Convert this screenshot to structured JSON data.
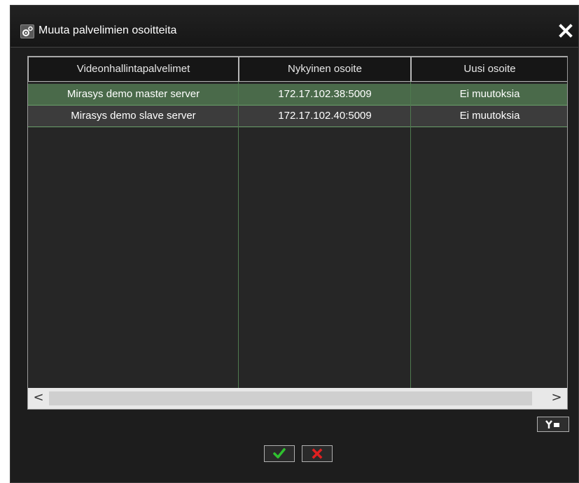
{
  "dialog": {
    "title": "Muuta palvelimien osoitteita",
    "title_icon": "servers-gear-icon",
    "close_icon": "close-icon"
  },
  "table": {
    "columns": [
      "Videonhallintapalvelimet",
      "Nykyinen osoite",
      "Uusi osoite"
    ],
    "rows": [
      {
        "server": "Mirasys demo master server",
        "current_address": "172.17.102.38:5009",
        "new_address": "Ei muutoksia",
        "selected": true
      },
      {
        "server": "Mirasys demo slave server",
        "current_address": "172.17.102.40:5009",
        "new_address": "Ei muutoksia",
        "selected": false
      }
    ],
    "scroll_left_icon": "<",
    "scroll_right_icon": ">"
  },
  "footer": {
    "settings_icon": "column-settings-icon",
    "ok_icon": "checkmark-icon",
    "cancel_icon": "x-cancel-icon"
  },
  "colors": {
    "dialog_bg": "#1d1d1d",
    "selected_row": "#4a6a4a",
    "ok_green": "#2fc02f",
    "cancel_red": "#e02020"
  }
}
